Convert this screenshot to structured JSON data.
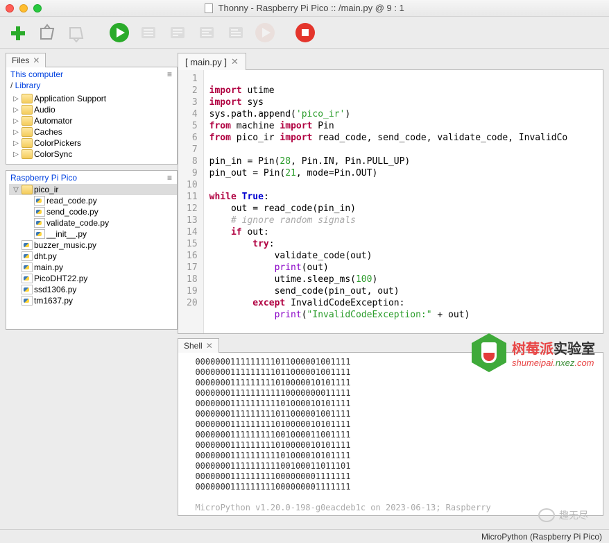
{
  "window": {
    "title": "Thonny  -  Raspberry Pi Pico :: /main.py  @  9 : 1"
  },
  "toolbar": {
    "new": "New",
    "open": "Open",
    "save": "Save",
    "run": "Run",
    "debug": "Debug",
    "over": "Step Over",
    "into": "Step Into",
    "out": "Step Out",
    "resume": "Resume",
    "stop": "Stop"
  },
  "panels": {
    "files_label": "Files",
    "this_computer": "This computer",
    "library_path": "Library",
    "folders": [
      "Application Support",
      "Audio",
      "Automator",
      "Caches",
      "ColorPickers",
      "ColorSync"
    ],
    "pico_label": "Raspberry Pi Pico",
    "pico_folder": "pico_ir",
    "pico_folder_files": [
      "read_code.py",
      "send_code.py",
      "validate_code.py",
      "__init__.py"
    ],
    "pico_files": [
      "buzzer_music.py",
      "dht.py",
      "main.py",
      "PicoDHT22.py",
      "ssd1306.py",
      "tm1637.py"
    ]
  },
  "editor": {
    "tab": "[ main.py ]",
    "line_count": 20
  },
  "code": {
    "l1a": "import",
    "l1b": " utime",
    "l2a": "import",
    "l2b": " sys",
    "l3a": "sys.path.append(",
    "l3b": "'pico_ir'",
    "l3c": ")",
    "l4a": "from",
    "l4b": " machine ",
    "l4c": "import",
    "l4d": " Pin",
    "l5a": "from",
    "l5b": " pico_ir ",
    "l5c": "import",
    "l5d": " read_code, send_code, validate_code, InvalidCo",
    "l7a": "pin_in = Pin(",
    "l7b": "28",
    "l7c": ", Pin.IN, Pin.PULL_UP)",
    "l8a": "pin_out = Pin(",
    "l8b": "21",
    "l8c": ", mode=Pin.OUT)",
    "l10a": "while",
    "l10b": " ",
    "l10c": "True",
    "l10d": ":",
    "l11": "    out = read_code(pin_in)",
    "l12": "    # ignore random signals",
    "l13a": "    ",
    "l13b": "if",
    "l13c": " out:",
    "l14a": "        ",
    "l14b": "try",
    "l14c": ":",
    "l15": "            validate_code(out)",
    "l16a": "            ",
    "l16b": "print",
    "l16c": "(out)",
    "l17a": "            utime.sleep_ms(",
    "l17b": "100",
    "l17c": ")",
    "l18": "            send_code(pin_out, out)",
    "l19a": "        ",
    "l19b": "except",
    "l19c": " InvalidCodeException:",
    "l20a": "            ",
    "l20b": "print",
    "l20c": "(",
    "l20d": "\"InvalidCodeException:\"",
    "l20e": " + out)"
  },
  "shell": {
    "label": "Shell",
    "lines": [
      "0000000111111111011000001001111",
      "0000000111111111011000001001111",
      "0000000111111111010000010101111",
      "0000000111111111110000000011111",
      "0000000111111111101000010101111",
      "0000000111111111011000001001111",
      "0000000111111111010000010101111",
      "0000000111111111001000011001111",
      "0000000111111111010000010101111",
      "0000000111111111101000010101111",
      "0000000111111111100100011011101",
      "0000000111111111000000001111111",
      "0000000111111111000000001111111"
    ],
    "footer": "MicroPython v1.20.0-198-g0eacdeb1c on 2023-06-13; Raspberry"
  },
  "status": {
    "interpreter": "MicroPython (Raspberry Pi Pico)"
  },
  "watermark": {
    "t1a": "树莓派",
    "t1b": "实验室",
    "t2a": "shumeipai.",
    "t2b": "nxez",
    "t2c": ".com",
    "bottom": "趣无尽"
  }
}
